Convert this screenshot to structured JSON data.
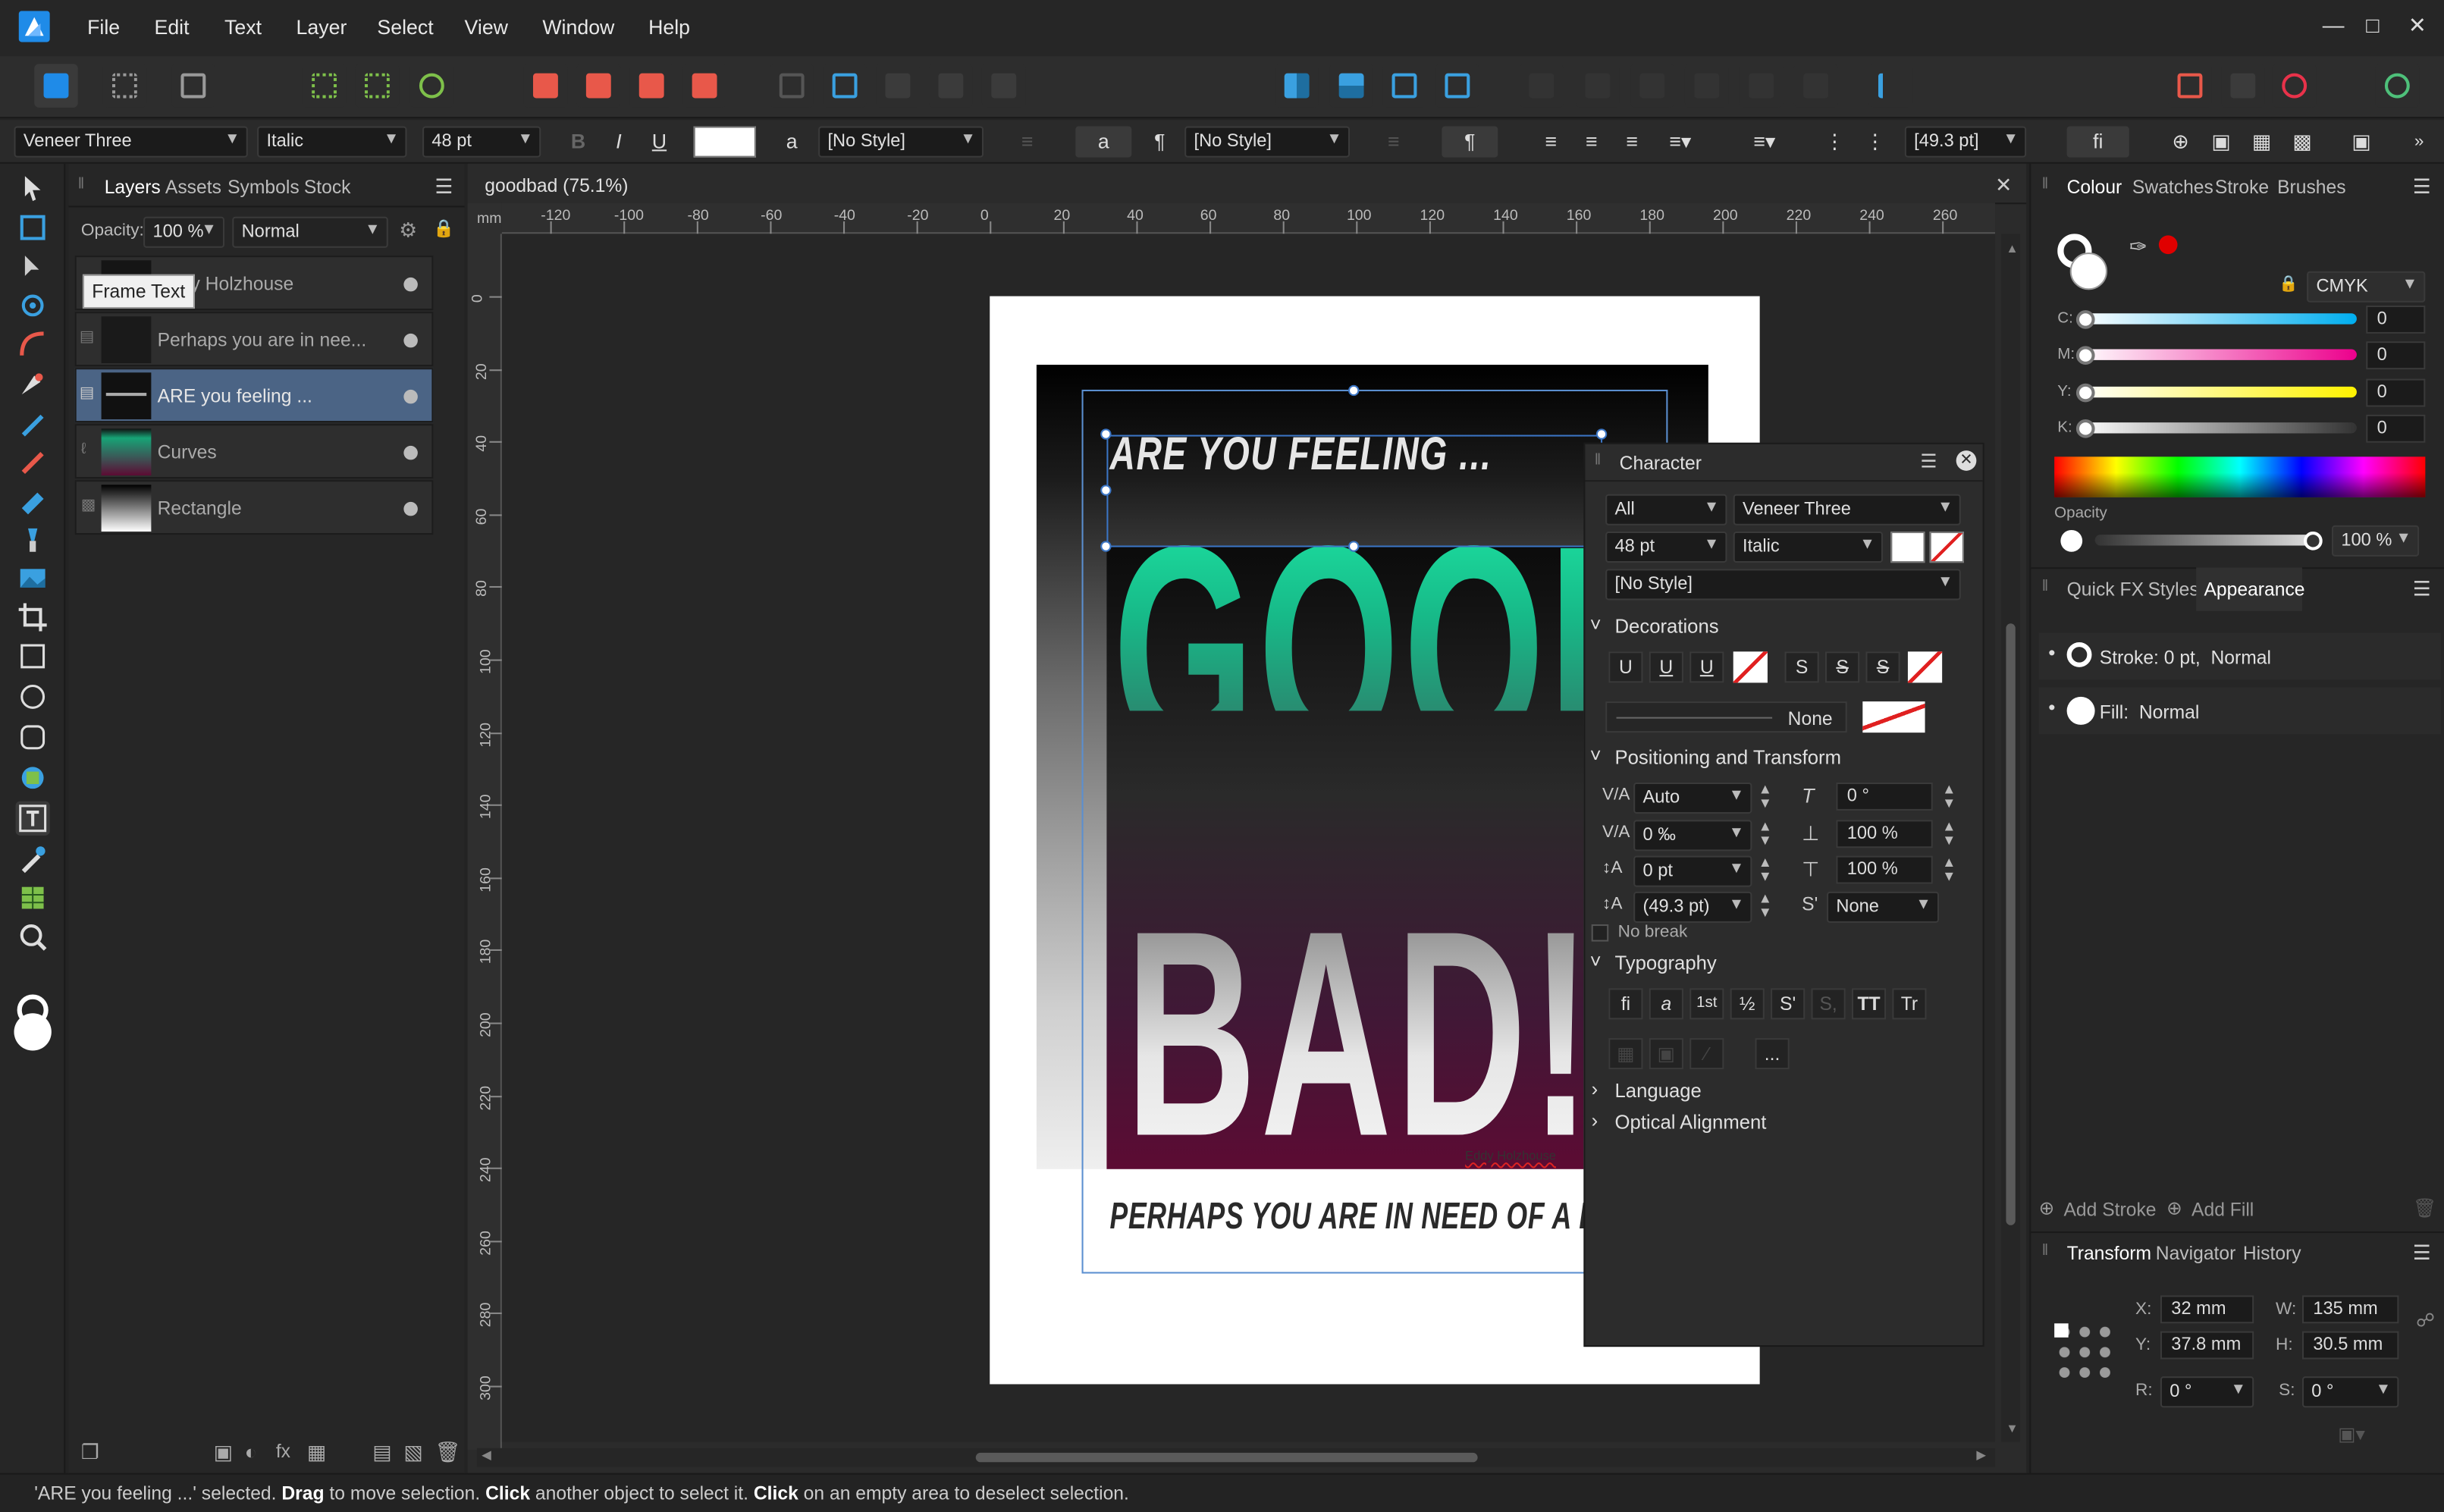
{
  "menu": [
    "File",
    "Edit",
    "Text",
    "Layer",
    "Select",
    "View",
    "Window",
    "Help"
  ],
  "context_bar": {
    "font": "Veneer Three",
    "style": "Italic",
    "size": "48 pt",
    "bold": "B",
    "italic": "I",
    "underline": "U",
    "char_style_a": "a",
    "char_style": "[No Style]",
    "para_a": "a",
    "para_mark": "¶",
    "para_style": "[No Style]",
    "para_mark2": "¶",
    "leading": "[49.3 pt]",
    "fi": "fi"
  },
  "layers_panel": {
    "tabs": [
      "Layers",
      "Assets",
      "Symbols",
      "Stock"
    ],
    "opacity_label": "Opacity:",
    "opacity": "100 %",
    "blend": "Normal",
    "tooltip": "Frame Text",
    "layers": [
      {
        "name": "Eddy Holzhouse",
        "visible_text": "ddy Holzhouse",
        "selected": false
      },
      {
        "name": "Perhaps you are in nee...",
        "selected": false
      },
      {
        "name": "ARE you feeling ...",
        "selected": true
      },
      {
        "name": "Curves",
        "selected": false
      },
      {
        "name": "Rectangle",
        "selected": false
      }
    ]
  },
  "document": {
    "tab_title": "goodbad (75.1%)",
    "ruler_h": [
      "-120",
      "-100",
      "-80",
      "-60",
      "-40",
      "-20",
      "0",
      "20",
      "40",
      "60",
      "80",
      "100",
      "120",
      "140",
      "160",
      "180",
      "200",
      "220",
      "240",
      "260"
    ],
    "ruler_v": [
      "0",
      "20",
      "40",
      "60",
      "80",
      "100",
      "120",
      "140",
      "160",
      "180",
      "200",
      "220",
      "240",
      "260",
      "280",
      "300"
    ],
    "ruler_unit": "mm",
    "artwork": {
      "headline": "ARE YOU FEELING ...",
      "word_good": "GOOD",
      "word_bad": "BAD!",
      "tagline": "PERHAPS YOU ARE IN NEED OF A LIFT?",
      "credit": "Eddy Holzhouse",
      "good_color": "#1de9a6",
      "bad_bg_color": "#5c0b33"
    }
  },
  "character_panel": {
    "title": "Character",
    "scope": "All",
    "font": "Veneer Three",
    "size": "48 pt",
    "style": "Italic",
    "para_style": "[No Style]",
    "decorations_label": "Decorations",
    "dec_buttons": [
      "U",
      "U",
      "U",
      "S",
      "S",
      "S"
    ],
    "line_none": "None",
    "positioning_label": "Positioning and Transform",
    "kerning": "Auto",
    "shear": "0 °",
    "tracking": "0 ‰",
    "vscale": "100 %",
    "baseline": "0 pt",
    "hscale": "100 %",
    "leading": "(49.3 pt)",
    "sub_super": "None",
    "no_break": "No break",
    "typography_label": "Typography",
    "typo_buttons": [
      "fi",
      "a",
      "1st",
      "½",
      "S'",
      "S,",
      "TT",
      "Tr"
    ],
    "more": "...",
    "language_label": "Language",
    "optical_label": "Optical Alignment"
  },
  "right_panel": {
    "tabs1": [
      "Colour",
      "Swatches",
      "Stroke",
      "Brushes"
    ],
    "color_model": "CMYK",
    "channels": [
      {
        "label": "C:",
        "value": "0",
        "color": "#00aeef"
      },
      {
        "label": "M:",
        "value": "0",
        "color": "#ec008c"
      },
      {
        "label": "Y:",
        "value": "0",
        "color": "#fff200"
      },
      {
        "label": "K:",
        "value": "0",
        "color": "#9a9a9a"
      }
    ],
    "opacity_label": "Opacity",
    "opacity": "100 %",
    "tabs2": [
      "Quick FX",
      "Styles",
      "Appearance"
    ],
    "stroke_label": "Stroke: 0 pt,  Normal",
    "fill_label": "Fill:  Normal",
    "add_stroke": "Add Stroke",
    "add_fill": "Add Fill",
    "tabs3": [
      "Transform",
      "Navigator",
      "History"
    ],
    "x_label": "X:",
    "x": "32 mm",
    "y_label": "Y:",
    "y": "37.8 mm",
    "w_label": "W:",
    "w": "135 mm",
    "h_label": "H:",
    "h": "30.5 mm",
    "r_label": "R:",
    "r": "0 °",
    "s_label": "S:",
    "s": "0 °"
  },
  "status": {
    "part1": "'ARE you feeling ...' selected. ",
    "b1": "Drag",
    "part2": " to move selection. ",
    "b2": "Click",
    "part3": " another object to select it. ",
    "b3": "Click",
    "part4": " on an empty area to deselect selection."
  }
}
